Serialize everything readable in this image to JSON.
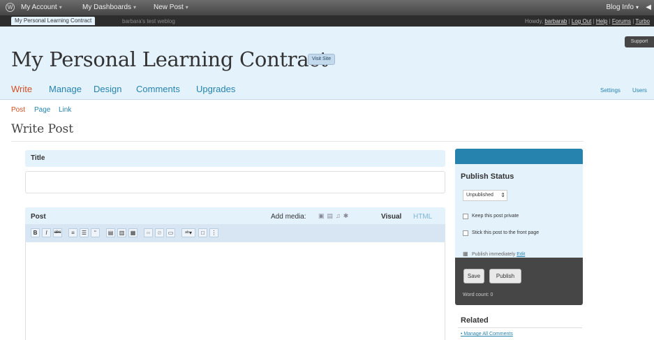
{
  "adminbar": {
    "menus": [
      "My Account",
      "My Dashboards",
      "New Post"
    ],
    "blog_info": "Blog Info",
    "arrow": "◀"
  },
  "strip": {
    "active_tab": "My Personal Learning Contract",
    "other_tab": "barbara's test weblog",
    "howdy": "Howdy,",
    "user": "barbarab",
    "links": [
      "Log Out",
      "Help",
      "Forums",
      "Turbo"
    ]
  },
  "support": "Support",
  "site_title": "My Personal Learning Contract",
  "visit_site": "Visit Site",
  "main_nav": [
    "Write",
    "Manage",
    "Design",
    "Comments",
    "Upgrades"
  ],
  "nav_right": [
    "Settings",
    "Users"
  ],
  "sub_nav": [
    "Post",
    "Page",
    "Link"
  ],
  "page_title": "Write Post",
  "title_box": {
    "label": "Title",
    "value": ""
  },
  "post_box": {
    "label": "Post",
    "add_media": "Add media:",
    "media_icons": [
      "image-icon",
      "video-icon",
      "audio-icon",
      "media-icon"
    ],
    "visual": "Visual",
    "html": "HTML",
    "toolbar_icons": [
      "bold-icon",
      "italic-icon",
      "strikethrough-icon",
      "bullet-list-icon",
      "numbered-list-icon",
      "blockquote-icon",
      "align-left-icon",
      "align-center-icon",
      "align-right-icon",
      "link-icon",
      "unlink-icon",
      "more-icon",
      "spellcheck-icon",
      "fullscreen-icon",
      "kitchen-sink-icon"
    ]
  },
  "publish": {
    "title": "Publish Status",
    "status": "Unpublished",
    "private_label": "Keep this post private",
    "sticky_label": "Stick this post to the front page",
    "publish_time": "Publish immediately",
    "edit": "Edit",
    "save": "Save",
    "publish": "Publish",
    "word_count": "Word count: 0"
  },
  "related": {
    "title": "Related",
    "link": "Manage All Comments"
  },
  "colors": {
    "accent": "#2683ae",
    "active_nav": "#d54e21",
    "header_bg": "#e4f2fc",
    "dark_bar": "#464646"
  }
}
